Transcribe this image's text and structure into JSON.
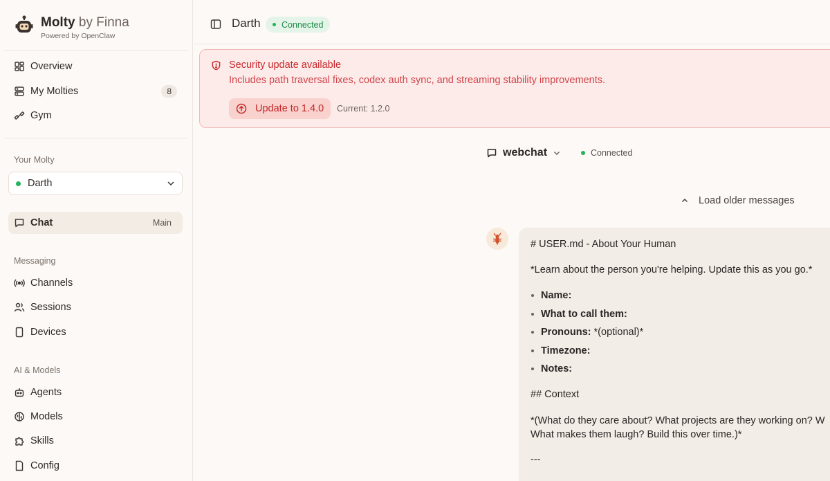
{
  "brand": {
    "name": "Molty",
    "by": "by Finna",
    "subtitle": "Powered by OpenClaw"
  },
  "nav_primary": [
    {
      "label": "Overview",
      "icon": "grid-icon"
    },
    {
      "label": "My Molties",
      "icon": "server-icon",
      "badge": "8"
    },
    {
      "label": "Gym",
      "icon": "dumbbell-icon"
    }
  ],
  "your_molty": {
    "section_label": "Your Molty",
    "selected": "Darth",
    "status_color": "#22b35b"
  },
  "chat_item": {
    "label": "Chat",
    "tag": "Main"
  },
  "messaging": {
    "section_label": "Messaging",
    "items": [
      {
        "label": "Channels",
        "icon": "broadcast-icon"
      },
      {
        "label": "Sessions",
        "icon": "users-icon"
      },
      {
        "label": "Devices",
        "icon": "device-icon"
      }
    ]
  },
  "ai_models": {
    "section_label": "AI & Models",
    "items": [
      {
        "label": "Agents",
        "icon": "bot-icon"
      },
      {
        "label": "Models",
        "icon": "brain-icon"
      },
      {
        "label": "Skills",
        "icon": "puzzle-icon"
      },
      {
        "label": "Config",
        "icon": "file-icon"
      }
    ]
  },
  "topbar": {
    "title": "Darth",
    "status": "Connected"
  },
  "alert": {
    "title": "Security update available",
    "description": "Includes path traversal fixes, codex auth sync, and streaming stability improvements.",
    "button_label": "Update to 1.4.0",
    "current_version": "Current: 1.2.0"
  },
  "channel": {
    "name": "webchat",
    "status": "Connected"
  },
  "load_older": "Load older messages",
  "message": {
    "h1": "# USER.md - About Your Human",
    "intro": "*Learn about the person you're helping. Update this as you go.*",
    "fields": [
      {
        "key": "Name:",
        "value": ""
      },
      {
        "key": "What to call them:",
        "value": ""
      },
      {
        "key": "Pronouns:",
        "value": " *(optional)*"
      },
      {
        "key": "Timezone:",
        "value": ""
      },
      {
        "key": "Notes:",
        "value": ""
      }
    ],
    "h2": "## Context",
    "context_line1": "*(What do they care about? What projects are they working on? W",
    "context_line2": "What makes them laugh? Build this over time.)*",
    "rule": "---"
  },
  "colors": {
    "accent_green": "#22b35b",
    "alert_red": "#c8282c",
    "background": "#fdf9f6"
  }
}
